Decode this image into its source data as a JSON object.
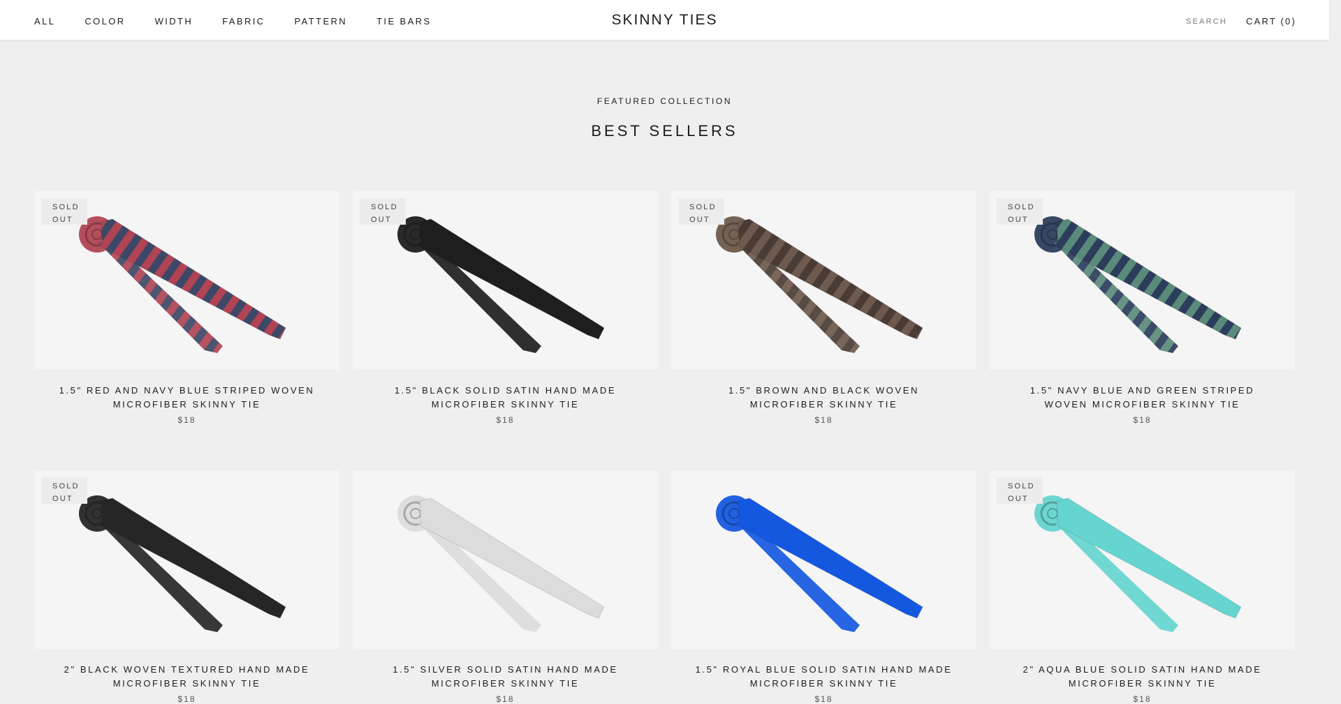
{
  "header": {
    "nav": [
      "ALL",
      "COLOR",
      "WIDTH",
      "FABRIC",
      "PATTERN",
      "TIE BARS"
    ],
    "brand": "SKINNY TIES",
    "search": "SEARCH",
    "cart": "CART (0)"
  },
  "section": {
    "kicker": "FEATURED COLLECTION",
    "title": "BEST SELLERS"
  },
  "products": [
    {
      "title": "1.5\" RED AND NAVY BLUE STRIPED WOVEN MICROFIBER SKINNY TIE",
      "price": "$18",
      "badge": "SOLD OUT",
      "sold_out": true,
      "colors": [
        "#b04454",
        "#3d4866"
      ]
    },
    {
      "title": "1.5\" BLACK SOLID SATIN HAND MADE MICROFIBER SKINNY TIE",
      "price": "$18",
      "badge": "SOLD OUT",
      "sold_out": true,
      "colors": [
        "#1e1e1e",
        "#1e1e1e"
      ]
    },
    {
      "title": "1.5\" BROWN AND BLACK WOVEN MICROFIBER SKINNY TIE",
      "price": "$18",
      "badge": "SOLD OUT",
      "sold_out": true,
      "colors": [
        "#6e5a4e",
        "#4a3c34"
      ]
    },
    {
      "title": "1.5\" NAVY BLUE AND GREEN STRIPED WOVEN MICROFIBER SKINNY TIE",
      "price": "$18",
      "badge": "SOLD OUT",
      "sold_out": true,
      "colors": [
        "#2c3d5c",
        "#5a8a7a"
      ]
    },
    {
      "title": "2\" BLACK WOVEN TEXTURED HAND MADE MICROFIBER SKINNY TIE",
      "price": "$18",
      "badge": "SOLD OUT",
      "sold_out": true,
      "colors": [
        "#262626",
        "#262626"
      ]
    },
    {
      "title": "1.5\" SILVER SOLID SATIN HAND MADE MICROFIBER SKINNY TIE",
      "price": "$18",
      "badge": "",
      "sold_out": false,
      "colors": [
        "#dcdcdc",
        "#dcdcdc"
      ]
    },
    {
      "title": "1.5\" ROYAL BLUE SOLID SATIN HAND MADE MICROFIBER SKINNY TIE",
      "price": "$18",
      "badge": "",
      "sold_out": false,
      "colors": [
        "#1558e0",
        "#1558e0"
      ]
    },
    {
      "title": "2\" AQUA BLUE SOLID SATIN HAND MADE MICROFIBER SKINNY TIE",
      "price": "$18",
      "badge": "SOLD OUT",
      "sold_out": true,
      "colors": [
        "#66d4cf",
        "#66d4cf"
      ]
    }
  ]
}
